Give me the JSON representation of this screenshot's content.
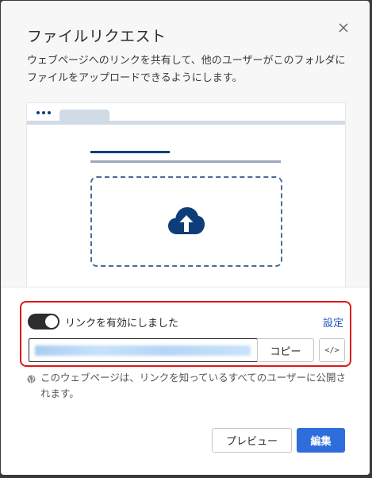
{
  "dialog": {
    "title": "ファイルリクエスト",
    "description": "ウェブページへのリンクを共有して、他のユーザーがこのフォルダにファイルをアップロードできるようにします。",
    "close_icon": "close-icon"
  },
  "illustration": {
    "icons": [
      "browser-dots-icon",
      "upload-cloud-icon"
    ]
  },
  "link_settings": {
    "toggle_on": true,
    "toggle_label": "リンクを有効にしました",
    "settings_label": "設定",
    "url_value": "",
    "copy_label": "コピー",
    "embed_label": "</>"
  },
  "notice": {
    "icon": "globe-icon",
    "text": "このウェブページは、リンクを知っているすべてのユーザーに公開されます。"
  },
  "footer": {
    "preview_label": "プレビュー",
    "edit_label": "編集"
  },
  "colors": {
    "accent": "#2f6ddc",
    "link": "#1f57c3",
    "highlight_border": "#e01515",
    "illustration_navy": "#0d3e7a"
  }
}
